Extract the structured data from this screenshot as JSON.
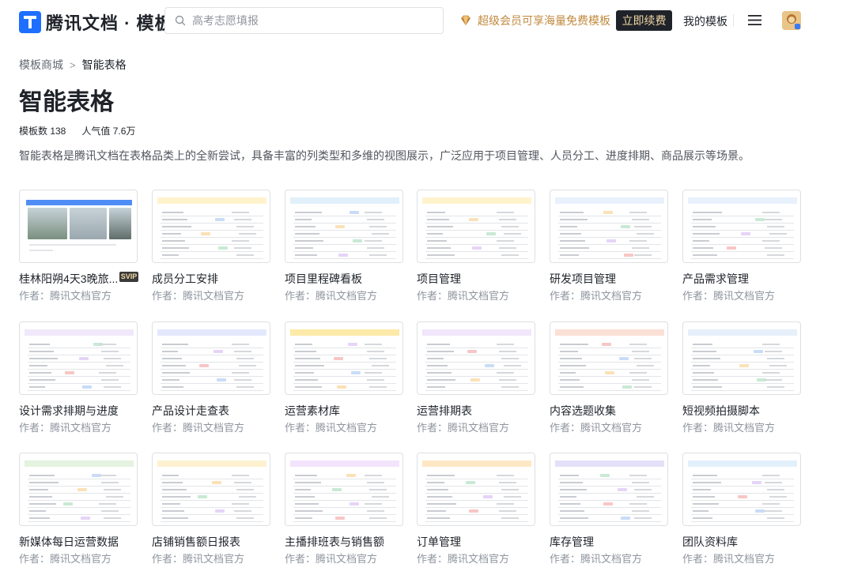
{
  "header": {
    "logo_text": "腾讯文档 · 模板",
    "search_placeholder": "高考志愿填报",
    "promo_text": "超级会员可享海量免费模板",
    "renew_button": "立即续费",
    "my_templates": "我的模板"
  },
  "breadcrumb": {
    "parent": "模板商城",
    "separator": ">",
    "current": "智能表格"
  },
  "page": {
    "title": "智能表格",
    "template_count": "模板数 138",
    "popularity": "人气值 7.6万",
    "description": "智能表格是腾讯文档在表格品类上的全新尝试，具备丰富的列类型和多维的视图展示，广泛应用于项目管理、人员分工、进度排期、商品展示等场景。"
  },
  "templates": [
    {
      "title": "桂林阳朔4天3晚旅...",
      "author": "作者：腾讯文档官方",
      "badge": "SVIP",
      "accent": "#4f8df5"
    },
    {
      "title": "成员分工安排",
      "author": "作者：腾讯文档官方",
      "accent": "#fff3cd"
    },
    {
      "title": "项目里程碑看板",
      "author": "作者：腾讯文档官方",
      "accent": "#e1f0fa"
    },
    {
      "title": "项目管理",
      "author": "作者：腾讯文档官方",
      "accent": "#fff3cd"
    },
    {
      "title": "研发项目管理",
      "author": "作者：腾讯文档官方",
      "accent": "#e8f1fc"
    },
    {
      "title": "产品需求管理",
      "author": "作者：腾讯文档官方",
      "accent": "#e8f1fc"
    },
    {
      "title": "设计需求排期与进度",
      "author": "作者：腾讯文档官方",
      "accent": "#f1e8fb"
    },
    {
      "title": "产品设计走查表",
      "author": "作者：腾讯文档官方",
      "accent": "#e4e8fd"
    },
    {
      "title": "运营素材库",
      "author": "作者：腾讯文档官方",
      "accent": "#fde9a8"
    },
    {
      "title": "运营排期表",
      "author": "作者：腾讯文档官方",
      "accent": "#f1e6fb"
    },
    {
      "title": "内容选题收集",
      "author": "作者：腾讯文档官方",
      "accent": "#fbe0d6"
    },
    {
      "title": "短视频拍摄脚本",
      "author": "作者：腾讯文档官方",
      "accent": "#e6f0fb"
    },
    {
      "title": "新媒体每日运营数据上报",
      "author": "作者：腾讯文档官方",
      "accent": "#e4f3df"
    },
    {
      "title": "店铺销售额日报表",
      "author": "作者：腾讯文档官方",
      "accent": "#fdf1cf"
    },
    {
      "title": "主播排班表与销售额统计",
      "author": "作者：腾讯文档官方",
      "accent": "#f3e4fb"
    },
    {
      "title": "订单管理",
      "author": "作者：腾讯文档官方",
      "accent": "#fde7c4"
    },
    {
      "title": "库存管理",
      "author": "作者：腾讯文档官方",
      "accent": "#e4e0f8"
    },
    {
      "title": "团队资料库",
      "author": "作者：腾讯文档官方",
      "accent": "#e2f0fb"
    }
  ],
  "colors": {
    "brand_blue": "#1e6fff",
    "promo_gold": "#c08a3e",
    "renew_bg": "#1f2329",
    "renew_text": "#f3d8a5"
  }
}
